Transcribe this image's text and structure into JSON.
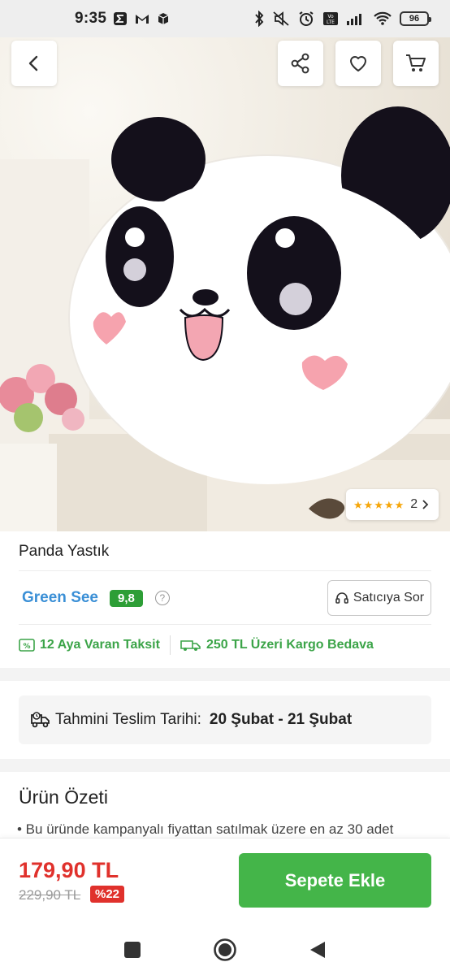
{
  "status_bar": {
    "time": "9:35",
    "left_icons": [
      "sigma-icon",
      "gmail-icon",
      "package-icon"
    ],
    "right_icons": [
      "bluetooth-icon",
      "mute-icon",
      "alarm-icon",
      "volte-icon",
      "signal-icon",
      "wifi-icon"
    ],
    "battery": "96"
  },
  "header": {
    "back_icon": "chevron-left-icon",
    "share_icon": "share-icon",
    "favorite_icon": "heart-icon",
    "cart_icon": "cart-icon"
  },
  "hero": {
    "rating_stars": 5,
    "rating_count": "2"
  },
  "product": {
    "title": "Panda Yastık"
  },
  "seller": {
    "name": "Green See",
    "score": "9,8",
    "help": "?",
    "ask_label": "Satıcıya Sor"
  },
  "info": {
    "installment": "12 Aya Varan Taksit",
    "shipping": "250 TL Üzeri Kargo Bedava",
    "color": "#3ba448"
  },
  "delivery": {
    "label": "Tahmini Teslim Tarihi:",
    "date": "20 Şubat - 21 Şubat"
  },
  "summary": {
    "title": "Ürün Özeti",
    "line": "• Bu üründe kampanyalı fiyattan satılmak üzere en az 30 adet"
  },
  "purchase": {
    "price": "179,90 TL",
    "old_price": "229,90 TL",
    "discount": "%22",
    "button": "Sepete Ekle",
    "price_color": "#e0312c",
    "button_color": "#44b549"
  },
  "nav": {
    "icons": [
      "recent-apps-icon",
      "home-icon",
      "back-triangle-icon"
    ]
  }
}
